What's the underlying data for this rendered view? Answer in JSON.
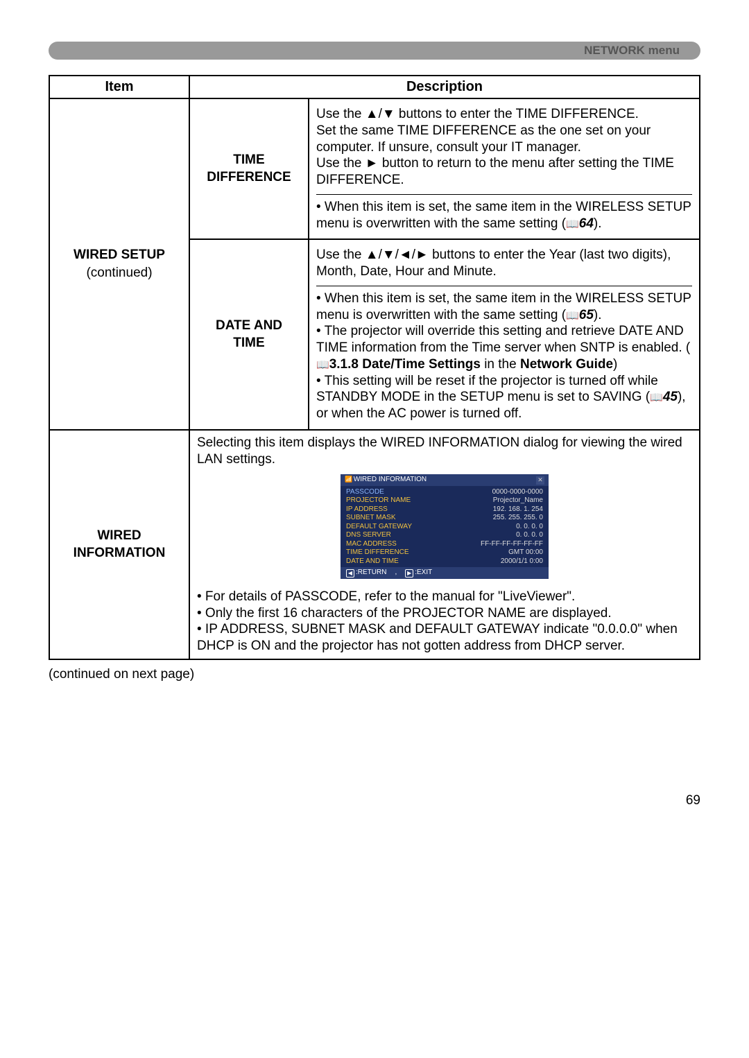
{
  "header": {
    "section_title": "NETWORK menu"
  },
  "table": {
    "headers": {
      "item": "Item",
      "description": "Description"
    },
    "row1": {
      "item_line1": "WIRED SETUP",
      "item_line2": "(continued)",
      "time_diff": {
        "label_line1": "TIME",
        "label_line2": "DIFFERENCE",
        "p1a": "Use the ▲/▼ buttons to enter the TIME DIFFERENCE.",
        "p1b": "Set the same TIME DIFFERENCE as the one set on your computer. If unsure, consult your IT manager.",
        "p1c": "Use the ► button to return to the menu after setting the TIME DIFFERENCE.",
        "p2a_prefix": "• When this item is set, the same item in the WIRELESS SETUP menu is overwritten with the same setting (",
        "p2a_ref": "64",
        "p2a_suffix": ")."
      },
      "date_time": {
        "label_line1": "DATE AND",
        "label_line2": "TIME",
        "p1": "Use the ▲/▼/◄/► buttons to enter the Year (last two digits), Month, Date, Hour and Minute.",
        "p2a_prefix": "• When this item is set, the same item in the WIRELESS SETUP menu is overwritten with the same setting (",
        "p2a_ref": "65",
        "p2a_suffix": ").",
        "p2b_prefix": "• The projector will override this setting and retrieve DATE AND TIME information from the Time server when SNTP is enabled. (",
        "p2b_ref": "3.1.8 Date/Time Settings",
        "p2b_mid": " in the ",
        "p2b_ref2": "Network Guide",
        "p2b_suffix": ")",
        "p2c_prefix": "• This setting will be reset if the projector is turned off while STANDBY MODE in the SETUP menu is set to SAVING (",
        "p2c_ref": "45",
        "p2c_suffix": "), or when the AC power is turned off."
      }
    },
    "row2": {
      "item_line1": "WIRED",
      "item_line2": "INFORMATION",
      "intro": "Selecting this item displays the WIRED INFORMATION dialog for viewing the wired LAN settings.",
      "dialog": {
        "title": "WIRED INFORMATION",
        "rows": [
          {
            "k": "PASSCODE",
            "v": "0000-0000-0000"
          },
          {
            "k": "PROJECTOR NAME",
            "v": "Projector_Name"
          },
          {
            "k": "IP ADDRESS",
            "v": "192. 168.  1. 254"
          },
          {
            "k": "SUBNET MASK",
            "v": "255. 255. 255.  0"
          },
          {
            "k": "DEFAULT GATEWAY",
            "v": "0.  0.  0.  0"
          },
          {
            "k": "DNS SERVER",
            "v": "0.  0.  0.  0"
          },
          {
            "k": "MAC ADDRESS",
            "v": "FF-FF-FF-FF-FF-FF"
          },
          {
            "k": "TIME DIFFERENCE",
            "v": "GMT 00:00"
          },
          {
            "k": "DATE AND TIME",
            "v": "2000/1/1  0:00"
          }
        ],
        "return_label": ":RETURN",
        "exit_label": ":EXIT"
      },
      "bullets": {
        "b1": "• For details of PASSCODE, refer to the manual for \"LiveViewer\".",
        "b2": "• Only the first 16 characters of the PROJECTOR NAME are displayed.",
        "b3": "• IP ADDRESS, SUBNET MASK and DEFAULT GATEWAY indicate \"0.0.0.0\" when DHCP is ON and the projector has not gotten address from DHCP server."
      }
    }
  },
  "footer_note": "(continued on next page)",
  "page_number": "69"
}
